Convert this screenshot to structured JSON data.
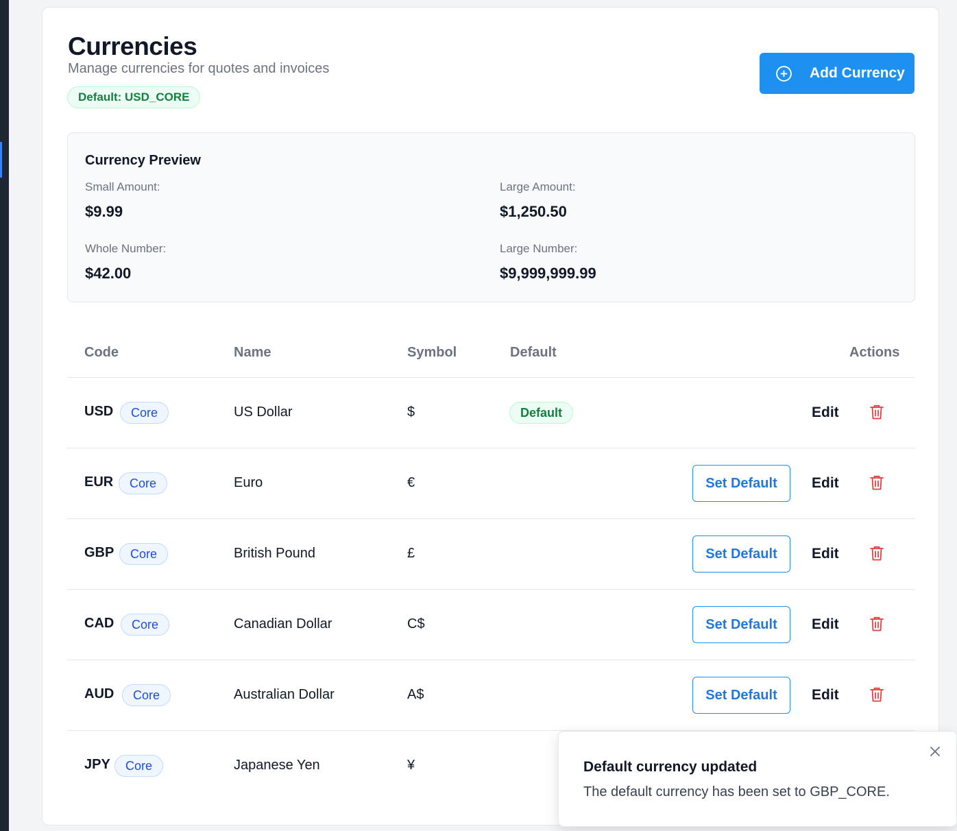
{
  "header": {
    "title": "Currencies",
    "subtitle": "Manage currencies for quotes and invoices",
    "default_badge": "Default: USD_CORE",
    "add_button_label": "Add Currency"
  },
  "preview": {
    "title": "Currency Preview",
    "small_label": "Small Amount:",
    "small_value": "$9.99",
    "large_amount_label": "Large Amount:",
    "large_amount_value": "$1,250.50",
    "whole_label": "Whole Number:",
    "whole_value": "$42.00",
    "large_number_label": "Large Number:",
    "large_number_value": "$9,999,999.99"
  },
  "table": {
    "columns": [
      "Code",
      "Name",
      "Symbol",
      "Default",
      "Actions"
    ],
    "core_label": "Core",
    "default_label": "Default",
    "set_default_label": "Set Default",
    "edit_label": "Edit",
    "rows": [
      {
        "code": "USD",
        "name": "US Dollar",
        "symbol": "$",
        "is_default": true
      },
      {
        "code": "EUR",
        "name": "Euro",
        "symbol": "€",
        "is_default": false
      },
      {
        "code": "GBP",
        "name": "British Pound",
        "symbol": "£",
        "is_default": false
      },
      {
        "code": "CAD",
        "name": "Canadian Dollar",
        "symbol": "C$",
        "is_default": false
      },
      {
        "code": "AUD",
        "name": "Australian Dollar",
        "symbol": "A$",
        "is_default": false
      },
      {
        "code": "JPY",
        "name": "Japanese Yen",
        "symbol": "¥",
        "is_default": false
      }
    ]
  },
  "toast": {
    "title": "Default currency updated",
    "message": "The default currency has been set to GBP_CORE."
  },
  "colors": {
    "accent": "#1e90f0",
    "success": "#15803d",
    "danger": "#e53e3e",
    "sidebar": "#1e2533"
  }
}
